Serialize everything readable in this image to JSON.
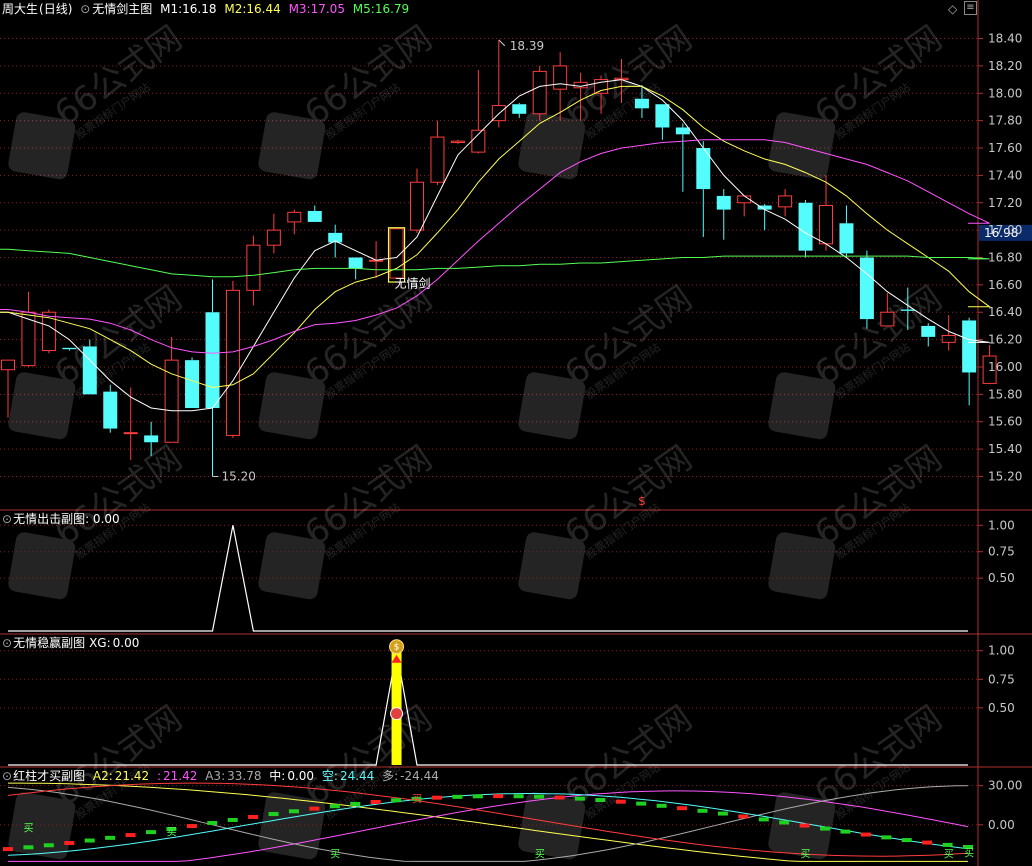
{
  "main_header": {
    "stock": "周大生",
    "period": "(日线)",
    "indicator": "无情剑主图",
    "m1_label": "M1:",
    "m1_value": "16.18",
    "m2_label": "M2:",
    "m2_value": "16.44",
    "m3_label": "M3:",
    "m3_value": "17.05",
    "m5_label": "M5:",
    "m5_value": "16.79",
    "diamond_icon": "◇",
    "menu_icon": "≡"
  },
  "colors": {
    "up": "#ff3c3c",
    "down": "#54fcfc",
    "m1": "#ffffff",
    "m2": "#ffff54",
    "m3": "#ff54ff",
    "m5": "#54ff54",
    "grid": "#8a1f1f",
    "axis_text": "#c8c8c8"
  },
  "main_axis_ticks": [
    "18.40",
    "18.20",
    "18.00",
    "17.80",
    "17.60",
    "17.40",
    "17.20",
    "17.00",
    "16.80",
    "16.60",
    "16.40",
    "16.20",
    "16.00",
    "15.80",
    "15.60",
    "15.40",
    "15.20"
  ],
  "current_price_label": "16.98",
  "high_label": "18.39",
  "low_label": "15.20",
  "signal_label": "无情剑",
  "marker_dollar": "$",
  "panels": {
    "p2": {
      "name": "无情出击副图",
      "value_text": ": 0.00",
      "ticks": [
        "1.00",
        "0.75",
        "0.50"
      ]
    },
    "p3": {
      "name": "无情稳赢副图",
      "label": "XG:",
      "value": "0.00",
      "ticks": [
        "1.00",
        "0.75",
        "0.50"
      ]
    },
    "p4": {
      "name": "红柱才买副图",
      "a2_label": "A2:",
      "a2_value": "21.42",
      "b_label": ":",
      "b_value": "21.42",
      "a3_label": "A3:",
      "a3_value": "33.78",
      "zhong_label": "中:",
      "zhong_value": "0.00",
      "kong_label": "空:",
      "kong_value": "24.44",
      "duo_label": "多:",
      "duo_value": "-24.44",
      "ticks": [
        "30.00",
        "0.00"
      ],
      "buy_glyph": "买"
    }
  },
  "watermark": {
    "text": "66公式网",
    "sub": "股票指标门户网站"
  },
  "chart_data": {
    "type": "candlestick",
    "ylim": [
      15.05,
      18.55
    ],
    "candles": [
      {
        "o": 15.98,
        "h": 16.0,
        "l": 15.63,
        "c": 16.05
      },
      {
        "o": 16.01,
        "h": 16.55,
        "l": 16.0,
        "c": 16.4
      },
      {
        "o": 16.12,
        "h": 16.42,
        "l": 16.1,
        "c": 16.4
      },
      {
        "o": 16.14,
        "h": 16.14,
        "l": 16.12,
        "c": 16.13
      },
      {
        "o": 16.15,
        "h": 16.2,
        "l": 15.8,
        "c": 15.8
      },
      {
        "o": 15.82,
        "h": 15.87,
        "l": 15.52,
        "c": 15.55
      },
      {
        "o": 15.52,
        "h": 15.85,
        "l": 15.32,
        "c": 15.52
      },
      {
        "o": 15.5,
        "h": 15.6,
        "l": 15.35,
        "c": 15.45
      },
      {
        "o": 15.45,
        "h": 16.22,
        "l": 15.45,
        "c": 16.05
      },
      {
        "o": 16.05,
        "h": 16.07,
        "l": 15.7,
        "c": 15.7
      },
      {
        "o": 16.4,
        "h": 16.64,
        "l": 15.2,
        "c": 15.7
      },
      {
        "o": 15.5,
        "h": 16.63,
        "l": 15.48,
        "c": 16.56
      },
      {
        "o": 16.56,
        "h": 16.96,
        "l": 16.45,
        "c": 16.89
      },
      {
        "o": 16.89,
        "h": 17.12,
        "l": 16.83,
        "c": 17.0
      },
      {
        "o": 17.06,
        "h": 17.15,
        "l": 16.97,
        "c": 17.13
      },
      {
        "o": 17.14,
        "h": 17.18,
        "l": 17.08,
        "c": 17.06
      },
      {
        "o": 16.98,
        "h": 17.04,
        "l": 16.8,
        "c": 16.91
      },
      {
        "o": 16.8,
        "h": 16.8,
        "l": 16.64,
        "c": 16.72
      },
      {
        "o": 16.78,
        "h": 16.92,
        "l": 16.65,
        "c": 16.78
      },
      {
        "o": 16.65,
        "h": 17.02,
        "l": 16.65,
        "c": 17.01
      },
      {
        "o": 17.0,
        "h": 17.45,
        "l": 16.98,
        "c": 17.35
      },
      {
        "o": 17.35,
        "h": 17.8,
        "l": 17.33,
        "c": 17.68
      },
      {
        "o": 17.64,
        "h": 17.66,
        "l": 17.63,
        "c": 17.65
      },
      {
        "o": 17.57,
        "h": 18.17,
        "l": 17.56,
        "c": 17.73
      },
      {
        "o": 17.8,
        "h": 18.39,
        "l": 17.75,
        "c": 17.91
      },
      {
        "o": 17.92,
        "h": 17.93,
        "l": 17.82,
        "c": 17.85
      },
      {
        "o": 17.85,
        "h": 18.2,
        "l": 17.8,
        "c": 18.16
      },
      {
        "o": 18.03,
        "h": 18.3,
        "l": 17.8,
        "c": 18.2
      },
      {
        "o": 18.04,
        "h": 18.15,
        "l": 17.8,
        "c": 18.08
      },
      {
        "o": 18.0,
        "h": 18.13,
        "l": 17.85,
        "c": 18.1
      },
      {
        "o": 18.1,
        "h": 18.25,
        "l": 17.93,
        "c": 18.11
      },
      {
        "o": 17.96,
        "h": 18.06,
        "l": 17.82,
        "c": 17.89
      },
      {
        "o": 17.92,
        "h": 17.92,
        "l": 17.66,
        "c": 17.75
      },
      {
        "o": 17.75,
        "h": 17.78,
        "l": 17.28,
        "c": 17.7
      },
      {
        "o": 17.6,
        "h": 17.65,
        "l": 16.95,
        "c": 17.3
      },
      {
        "o": 17.25,
        "h": 17.3,
        "l": 16.93,
        "c": 17.15
      },
      {
        "o": 17.2,
        "h": 17.25,
        "l": 17.1,
        "c": 17.25
      },
      {
        "o": 17.18,
        "h": 17.19,
        "l": 17.0,
        "c": 17.15
      },
      {
        "o": 17.17,
        "h": 17.3,
        "l": 17.1,
        "c": 17.25
      },
      {
        "o": 17.2,
        "h": 17.22,
        "l": 16.8,
        "c": 16.85
      },
      {
        "o": 16.9,
        "h": 17.4,
        "l": 16.85,
        "c": 17.18
      },
      {
        "o": 17.05,
        "h": 17.18,
        "l": 16.8,
        "c": 16.83
      },
      {
        "o": 16.8,
        "h": 16.85,
        "l": 16.28,
        "c": 16.35
      },
      {
        "o": 16.3,
        "h": 16.54,
        "l": 16.3,
        "c": 16.4
      },
      {
        "o": 16.42,
        "h": 16.58,
        "l": 16.27,
        "c": 16.41
      },
      {
        "o": 16.3,
        "h": 16.32,
        "l": 16.15,
        "c": 16.22
      },
      {
        "o": 16.18,
        "h": 16.38,
        "l": 16.12,
        "c": 16.23
      },
      {
        "o": 16.34,
        "h": 16.36,
        "l": 15.72,
        "c": 15.96
      },
      {
        "o": 15.88,
        "h": 16.16,
        "l": 15.88,
        "c": 16.08
      }
    ],
    "ma": {
      "M1": [
        16.4,
        16.35,
        16.3,
        16.2,
        16.05,
        15.9,
        15.78,
        15.7,
        15.68,
        15.68,
        15.7,
        15.9,
        16.15,
        16.4,
        16.65,
        16.85,
        16.92,
        16.85,
        16.78,
        16.8,
        16.95,
        17.25,
        17.55,
        17.7,
        17.85,
        17.98,
        18.05,
        18.07,
        18.05,
        18.08,
        18.1,
        18.05,
        17.95,
        17.8,
        17.6,
        17.4,
        17.25,
        17.15,
        17.08,
        16.98,
        16.9,
        16.8,
        16.68,
        16.55,
        16.45,
        16.35,
        16.26,
        16.2,
        16.18
      ],
      "M2": [
        16.4,
        16.38,
        16.36,
        16.32,
        16.28,
        16.2,
        16.12,
        16.02,
        15.95,
        15.9,
        15.85,
        15.87,
        15.95,
        16.1,
        16.25,
        16.42,
        16.55,
        16.62,
        16.66,
        16.72,
        16.82,
        16.98,
        17.15,
        17.35,
        17.52,
        17.65,
        17.78,
        17.86,
        17.95,
        18.02,
        18.05,
        18.05,
        17.98,
        17.88,
        17.75,
        17.65,
        17.58,
        17.52,
        17.48,
        17.42,
        17.35,
        17.25,
        17.12,
        17.0,
        16.9,
        16.8,
        16.7,
        16.55,
        16.44
      ],
      "M3": [
        16.42,
        16.4,
        16.37,
        16.36,
        16.35,
        16.32,
        16.27,
        16.2,
        16.14,
        16.11,
        16.1,
        16.11,
        16.15,
        16.2,
        16.26,
        16.31,
        16.32,
        16.34,
        16.38,
        16.43,
        16.52,
        16.64,
        16.78,
        16.92,
        17.05,
        17.18,
        17.3,
        17.42,
        17.5,
        17.56,
        17.6,
        17.62,
        17.64,
        17.65,
        17.66,
        17.66,
        17.66,
        17.66,
        17.64,
        17.6,
        17.56,
        17.52,
        17.48,
        17.42,
        17.36,
        17.28,
        17.2,
        17.12,
        17.05
      ],
      "M5": [
        16.86,
        16.85,
        16.84,
        16.83,
        16.8,
        16.77,
        16.74,
        16.71,
        16.68,
        16.67,
        16.66,
        16.66,
        16.67,
        16.69,
        16.71,
        16.72,
        16.72,
        16.72,
        16.71,
        16.71,
        16.71,
        16.72,
        16.72,
        16.73,
        16.74,
        16.74,
        16.75,
        16.75,
        16.76,
        16.76,
        16.77,
        16.78,
        16.79,
        16.8,
        16.8,
        16.81,
        16.81,
        16.81,
        16.81,
        16.81,
        16.81,
        16.81,
        16.81,
        16.81,
        16.81,
        16.8,
        16.8,
        16.8,
        16.79
      ]
    }
  }
}
